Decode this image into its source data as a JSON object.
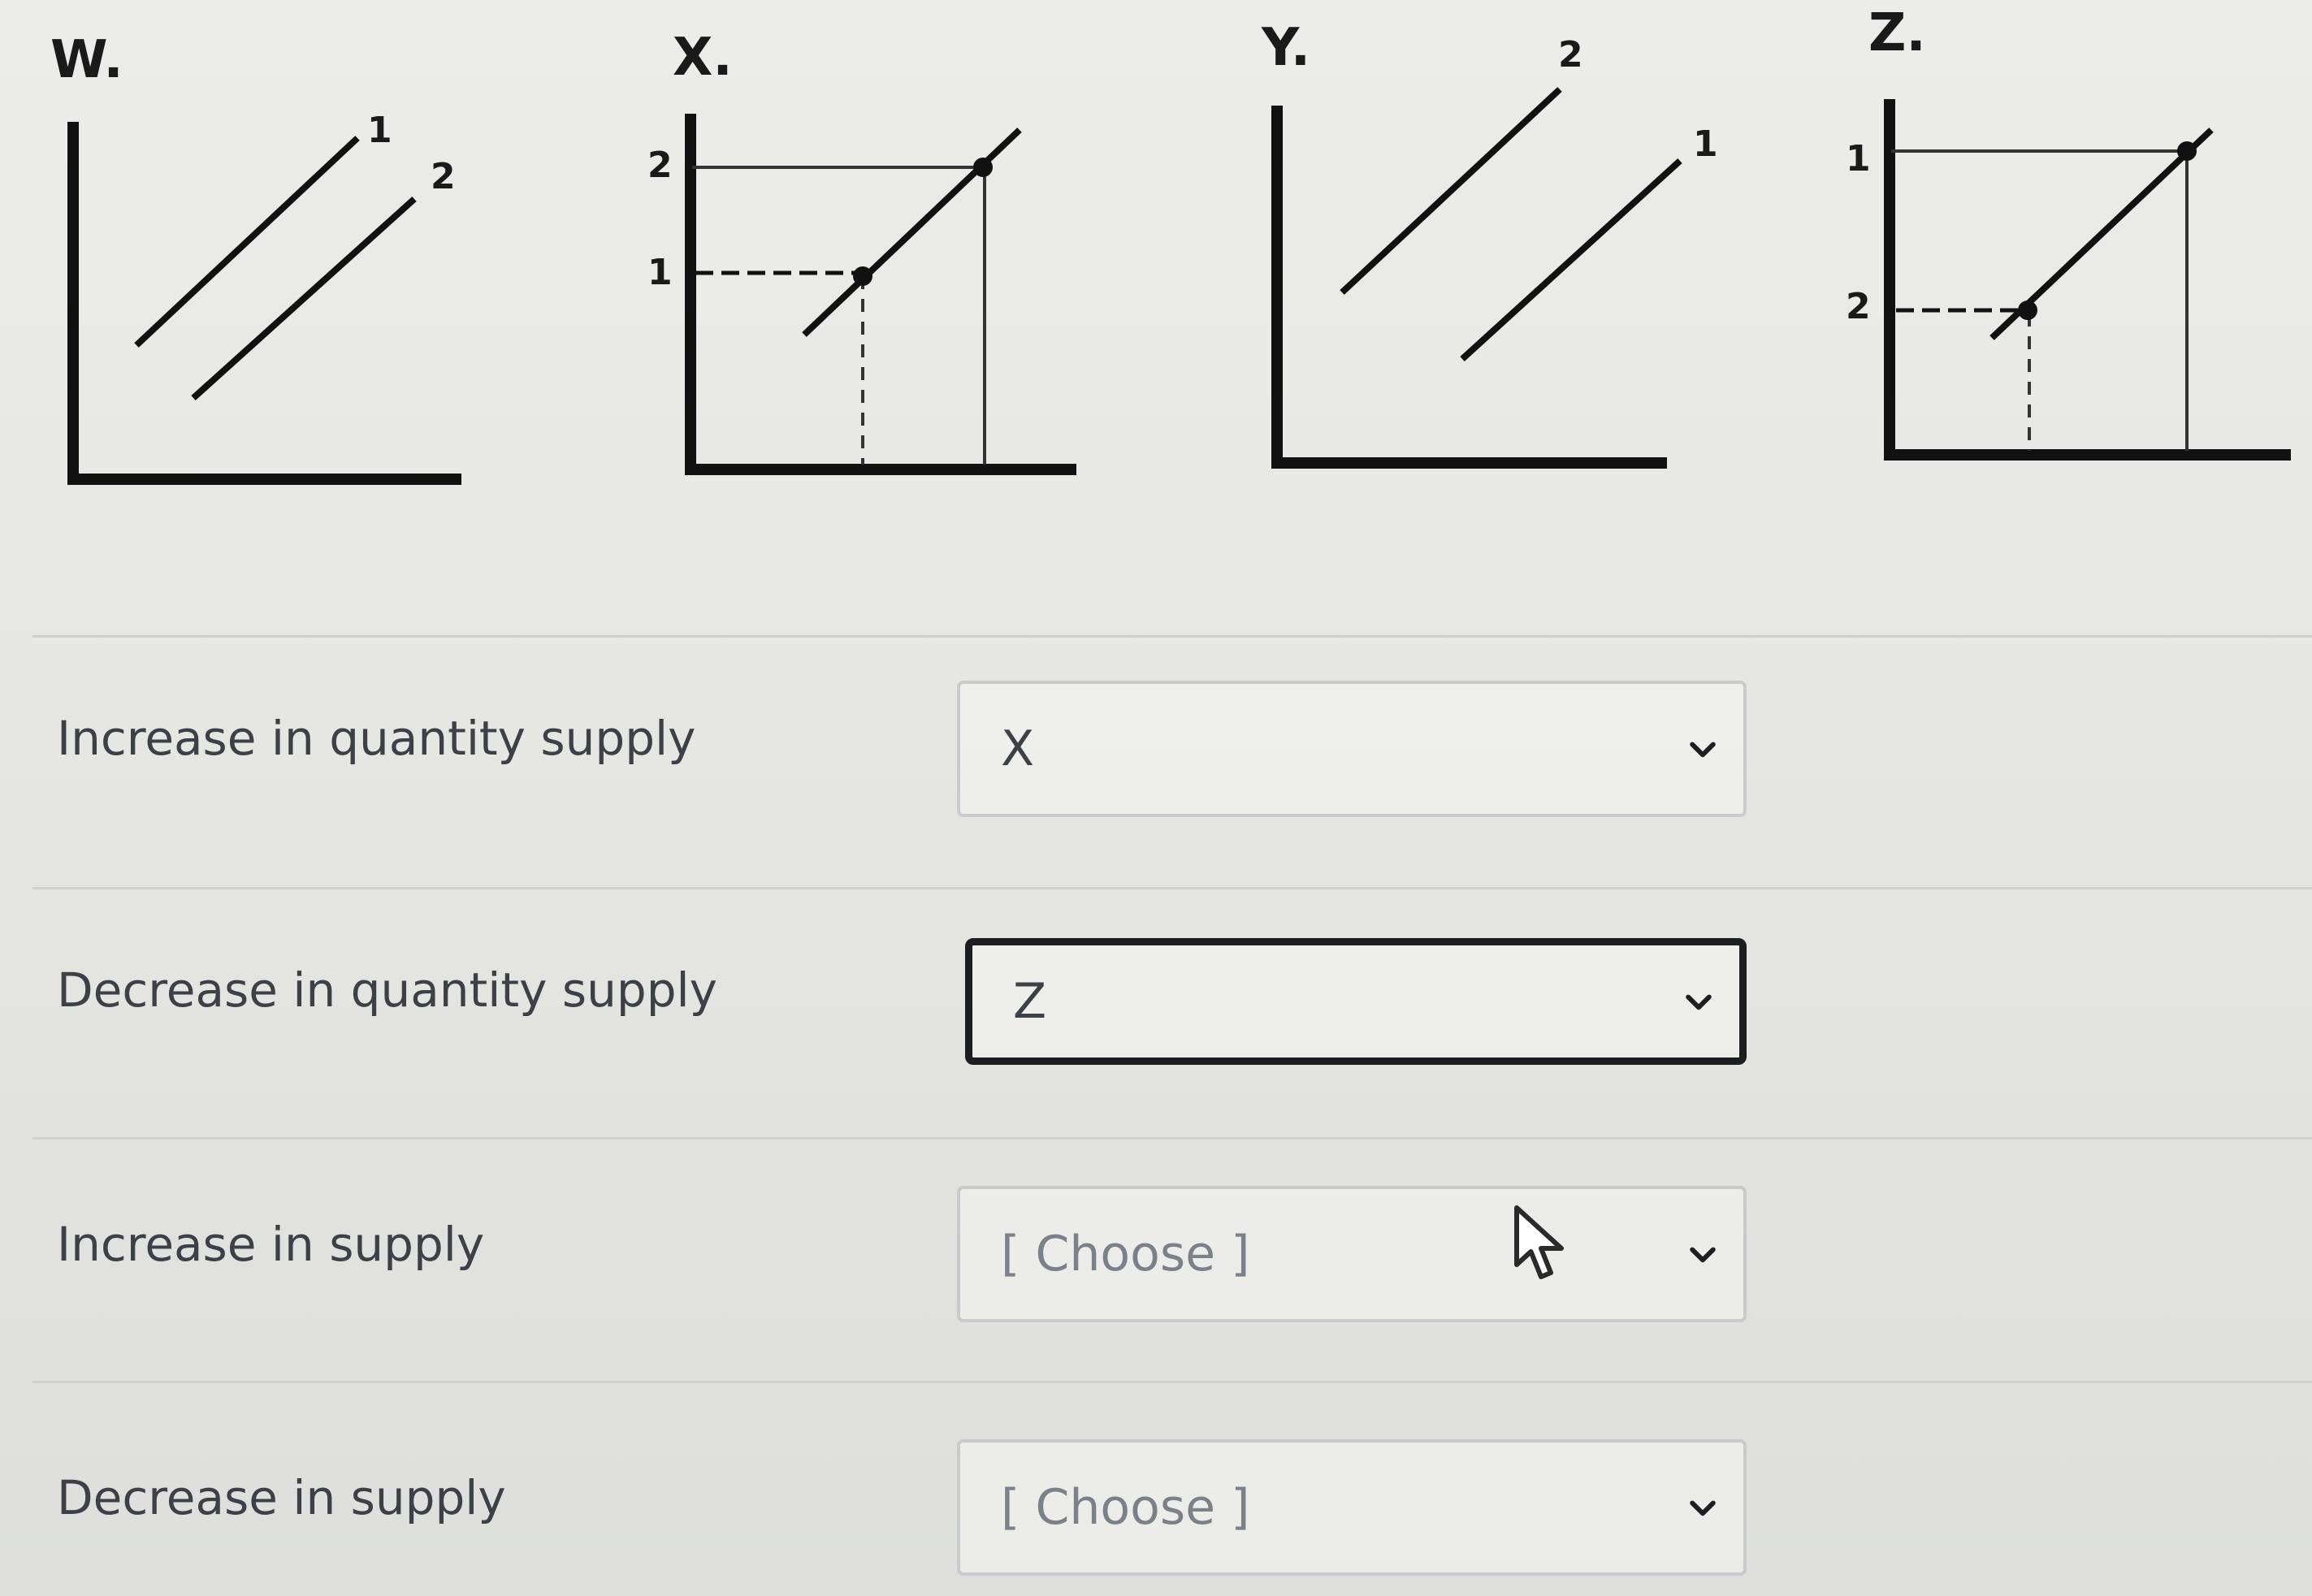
{
  "graphs": [
    {
      "id": "W",
      "title": "W.",
      "labels": [
        "1",
        "2"
      ]
    },
    {
      "id": "X",
      "title": "X.",
      "labels": [
        "2",
        "1"
      ]
    },
    {
      "id": "Y",
      "title": "Y.",
      "labels": [
        "2",
        "1"
      ]
    },
    {
      "id": "Z",
      "title": "Z.",
      "labels": [
        "1",
        "2"
      ]
    }
  ],
  "questions": [
    {
      "label": "Increase in quantity supply",
      "selected": "X",
      "state": "filled"
    },
    {
      "label": "Decrease in quantity supply",
      "selected": "Z",
      "state": "focused"
    },
    {
      "label": "Increase in supply",
      "selected": "[ Choose ]",
      "state": "placeholder"
    },
    {
      "label": "Decrease in supply",
      "selected": "[ Choose ]",
      "state": "placeholder"
    }
  ],
  "icons": {
    "dropdown": "chevron-down-icon",
    "pointer": "mouse-pointer-icon"
  },
  "colors": {
    "ink": "#1a1a1a",
    "text": "#3d4046",
    "placeholder": "#7c8088",
    "focus_border": "#1b1d20",
    "border": "#c9cacb"
  }
}
